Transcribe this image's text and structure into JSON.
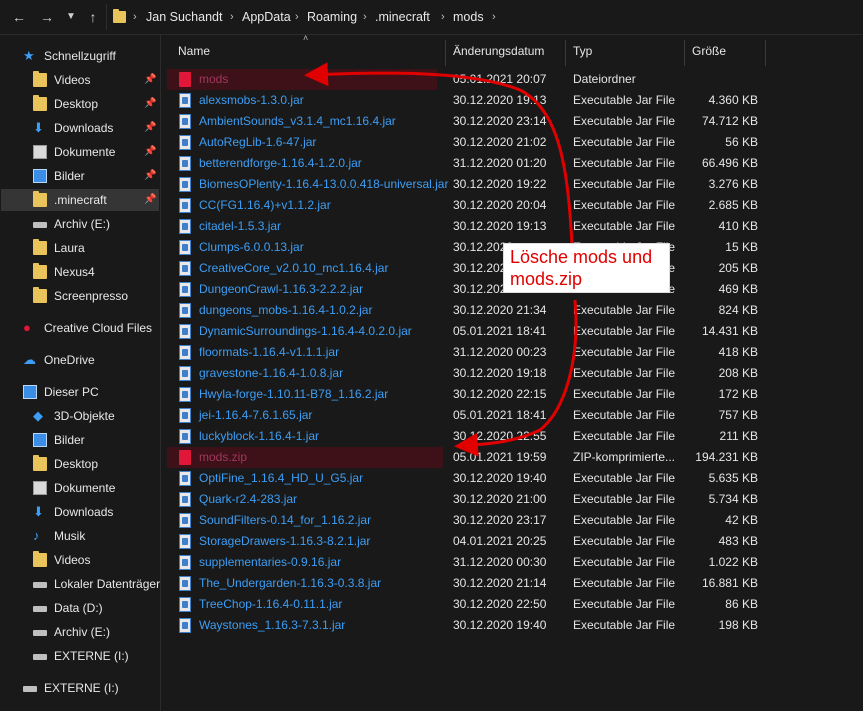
{
  "address": {
    "back_icon": "back-arrow-icon",
    "crumbs": [
      "Jan Suchandt",
      "AppData",
      "Roaming",
      ".minecraft",
      "mods"
    ]
  },
  "sidebar": {
    "items": [
      {
        "label": "Schnellzugriff",
        "icon": "star-icon",
        "pinned": false
      },
      {
        "label": "Videos",
        "icon": "video-folder-icon",
        "pinned": true
      },
      {
        "label": "Desktop",
        "icon": "desktop-folder-icon",
        "pinned": true
      },
      {
        "label": "Downloads",
        "icon": "downloads-icon",
        "pinned": true
      },
      {
        "label": "Dokumente",
        "icon": "documents-icon",
        "pinned": true
      },
      {
        "label": "Bilder",
        "icon": "pictures-icon",
        "pinned": true
      },
      {
        "label": ".minecraft",
        "icon": "folder-icon",
        "pinned": true
      },
      {
        "label": "Archiv (E:)",
        "icon": "drive-icon",
        "pinned": false
      },
      {
        "label": "Laura",
        "icon": "folder-icon",
        "pinned": false
      },
      {
        "label": "Nexus4",
        "icon": "folder-icon",
        "pinned": false
      },
      {
        "label": "Screenpresso",
        "icon": "folder-icon",
        "pinned": false
      },
      {
        "label": "Creative Cloud Files",
        "icon": "creative-cloud-icon",
        "pinned": false
      },
      {
        "label": "OneDrive",
        "icon": "cloud-icon",
        "pinned": false
      },
      {
        "label": "Dieser PC",
        "icon": "computer-icon",
        "pinned": false
      },
      {
        "label": "3D-Objekte",
        "icon": "3d-objects-icon",
        "pinned": false
      },
      {
        "label": "Bilder",
        "icon": "pictures-icon",
        "pinned": false
      },
      {
        "label": "Desktop",
        "icon": "desktop-folder-icon",
        "pinned": false
      },
      {
        "label": "Dokumente",
        "icon": "documents-icon",
        "pinned": false
      },
      {
        "label": "Downloads",
        "icon": "downloads-icon",
        "pinned": false
      },
      {
        "label": "Musik",
        "icon": "music-icon",
        "pinned": false
      },
      {
        "label": "Videos",
        "icon": "video-folder-icon",
        "pinned": false
      },
      {
        "label": "Lokaler Datenträger",
        "icon": "drive-icon",
        "pinned": false
      },
      {
        "label": "Data (D:)",
        "icon": "drive-icon",
        "pinned": false
      },
      {
        "label": "Archiv (E:)",
        "icon": "drive-icon",
        "pinned": false
      },
      {
        "label": "EXTERNE (I:)",
        "icon": "drive-icon",
        "pinned": false
      },
      {
        "label": "EXTERNE (I:)",
        "icon": "drive-icon",
        "pinned": false
      }
    ]
  },
  "columns": {
    "name": "Name",
    "date": "Änderungsdatum",
    "type": "Typ",
    "size": "Größe"
  },
  "files": [
    {
      "name": "mods",
      "date": "05.01.2021 20:07",
      "type": "Dateiordner",
      "size": "",
      "kind": "folder",
      "selected": true
    },
    {
      "name": "alexsmobs-1.3.0.jar",
      "date": "30.12.2020 19:13",
      "type": "Executable Jar File",
      "size": "4.360 KB",
      "kind": "jar"
    },
    {
      "name": "AmbientSounds_v3.1.4_mc1.16.4.jar",
      "date": "30.12.2020 23:14",
      "type": "Executable Jar File",
      "size": "74.712 KB",
      "kind": "jar"
    },
    {
      "name": "AutoRegLib-1.6-47.jar",
      "date": "30.12.2020 21:02",
      "type": "Executable Jar File",
      "size": "56 KB",
      "kind": "jar"
    },
    {
      "name": "betterendforge-1.16.4-1.2.0.jar",
      "date": "31.12.2020 01:20",
      "type": "Executable Jar File",
      "size": "66.496 KB",
      "kind": "jar"
    },
    {
      "name": "BiomesOPlenty-1.16.4-13.0.0.418-universal.jar",
      "date": "30.12.2020 19:22",
      "type": "Executable Jar File",
      "size": "3.276 KB",
      "kind": "jar"
    },
    {
      "name": "CC(FG1.16.4)+v1.1.2.jar",
      "date": "30.12.2020 20:04",
      "type": "Executable Jar File",
      "size": "2.685 KB",
      "kind": "jar"
    },
    {
      "name": "citadel-1.5.3.jar",
      "date": "30.12.2020 19:13",
      "type": "Executable Jar File",
      "size": "410 KB",
      "kind": "jar"
    },
    {
      "name": "Clumps-6.0.0.13.jar",
      "date": "30.12.2020",
      "type": "Executable Jar File",
      "size": "15 KB",
      "kind": "jar"
    },
    {
      "name": "CreativeCore_v2.0.10_mc1.16.4.jar",
      "date": "30.12.2020",
      "type": "Executable Jar File",
      "size": "205 KB",
      "kind": "jar"
    },
    {
      "name": "DungeonCrawl-1.16.3-2.2.2.jar",
      "date": "30.12.2020",
      "type": "Executable Jar File",
      "size": "469 KB",
      "kind": "jar"
    },
    {
      "name": "dungeons_mobs-1.16.4-1.0.2.jar",
      "date": "30.12.2020 21:34",
      "type": "Executable Jar File",
      "size": "824 KB",
      "kind": "jar"
    },
    {
      "name": "DynamicSurroundings-1.16.4-4.0.2.0.jar",
      "date": "05.01.2021 18:41",
      "type": "Executable Jar File",
      "size": "14.431 KB",
      "kind": "jar"
    },
    {
      "name": "floormats-1.16.4-v1.1.1.jar",
      "date": "31.12.2020 00:23",
      "type": "Executable Jar File",
      "size": "418 KB",
      "kind": "jar"
    },
    {
      "name": "gravestone-1.16.4-1.0.8.jar",
      "date": "30.12.2020 19:18",
      "type": "Executable Jar File",
      "size": "208 KB",
      "kind": "jar"
    },
    {
      "name": "Hwyla-forge-1.10.11-B78_1.16.2.jar",
      "date": "30.12.2020 22:15",
      "type": "Executable Jar File",
      "size": "172 KB",
      "kind": "jar"
    },
    {
      "name": "jei-1.16.4-7.6.1.65.jar",
      "date": "05.01.2021 18:41",
      "type": "Executable Jar File",
      "size": "757 KB",
      "kind": "jar"
    },
    {
      "name": "luckyblock-1.16.4-1.jar",
      "date": "30.12.2020 22:55",
      "type": "Executable Jar File",
      "size": "211 KB",
      "kind": "jar"
    },
    {
      "name": "mods.zip",
      "date": "05.01.2021 19:59",
      "type": "ZIP-komprimierte...",
      "size": "194.231 KB",
      "kind": "zip",
      "selected": true
    },
    {
      "name": "OptiFine_1.16.4_HD_U_G5.jar",
      "date": "30.12.2020 19:40",
      "type": "Executable Jar File",
      "size": "5.635 KB",
      "kind": "jar"
    },
    {
      "name": "Quark-r2.4-283.jar",
      "date": "30.12.2020 21:00",
      "type": "Executable Jar File",
      "size": "5.734 KB",
      "kind": "jar"
    },
    {
      "name": "SoundFilters-0.14_for_1.16.2.jar",
      "date": "30.12.2020 23:17",
      "type": "Executable Jar File",
      "size": "42 KB",
      "kind": "jar"
    },
    {
      "name": "StorageDrawers-1.16.3-8.2.1.jar",
      "date": "04.01.2021 20:25",
      "type": "Executable Jar File",
      "size": "483 KB",
      "kind": "jar"
    },
    {
      "name": "supplementaries-0.9.16.jar",
      "date": "31.12.2020 00:30",
      "type": "Executable Jar File",
      "size": "1.022 KB",
      "kind": "jar"
    },
    {
      "name": "The_Undergarden-1.16.3-0.3.8.jar",
      "date": "30.12.2020 21:14",
      "type": "Executable Jar File",
      "size": "16.881 KB",
      "kind": "jar"
    },
    {
      "name": "TreeChop-1.16.4-0.11.1.jar",
      "date": "30.12.2020 22:50",
      "type": "Executable Jar File",
      "size": "86 KB",
      "kind": "jar"
    },
    {
      "name": "Waystones_1.16.3-7.3.1.jar",
      "date": "30.12.2020 19:40",
      "type": "Executable Jar File",
      "size": "198 KB",
      "kind": "jar"
    }
  ],
  "annotation": {
    "line1": "Lösche mods und",
    "line2": "mods.zip",
    "color": "#e00000"
  }
}
